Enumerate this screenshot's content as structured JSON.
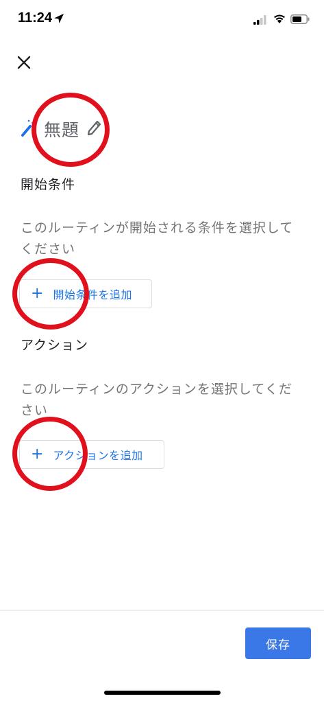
{
  "status_bar": {
    "time": "11:24",
    "icons": [
      "location-arrow-icon",
      "cellular-signal-icon",
      "wifi-icon",
      "battery-icon"
    ]
  },
  "header": {
    "close_icon": "close-icon",
    "title": "無題",
    "title_icon": "magic-wand-icon",
    "edit_icon": "pencil-icon"
  },
  "start_conditions": {
    "heading": "開始条件",
    "description": "このルーティンが開始される条件を選択してください",
    "add_button_label": "開始条件を追加",
    "add_icon": "plus-icon"
  },
  "actions": {
    "heading": "アクション",
    "description": "このルーティンのアクションを選択してください",
    "add_button_label": "アクションを追加",
    "add_icon": "plus-icon"
  },
  "footer": {
    "save_label": "保存"
  },
  "colors": {
    "accent": "#1a73e8",
    "save_button": "#3b78e7",
    "annotation": "#e0101c",
    "secondary_text": "#757575"
  }
}
